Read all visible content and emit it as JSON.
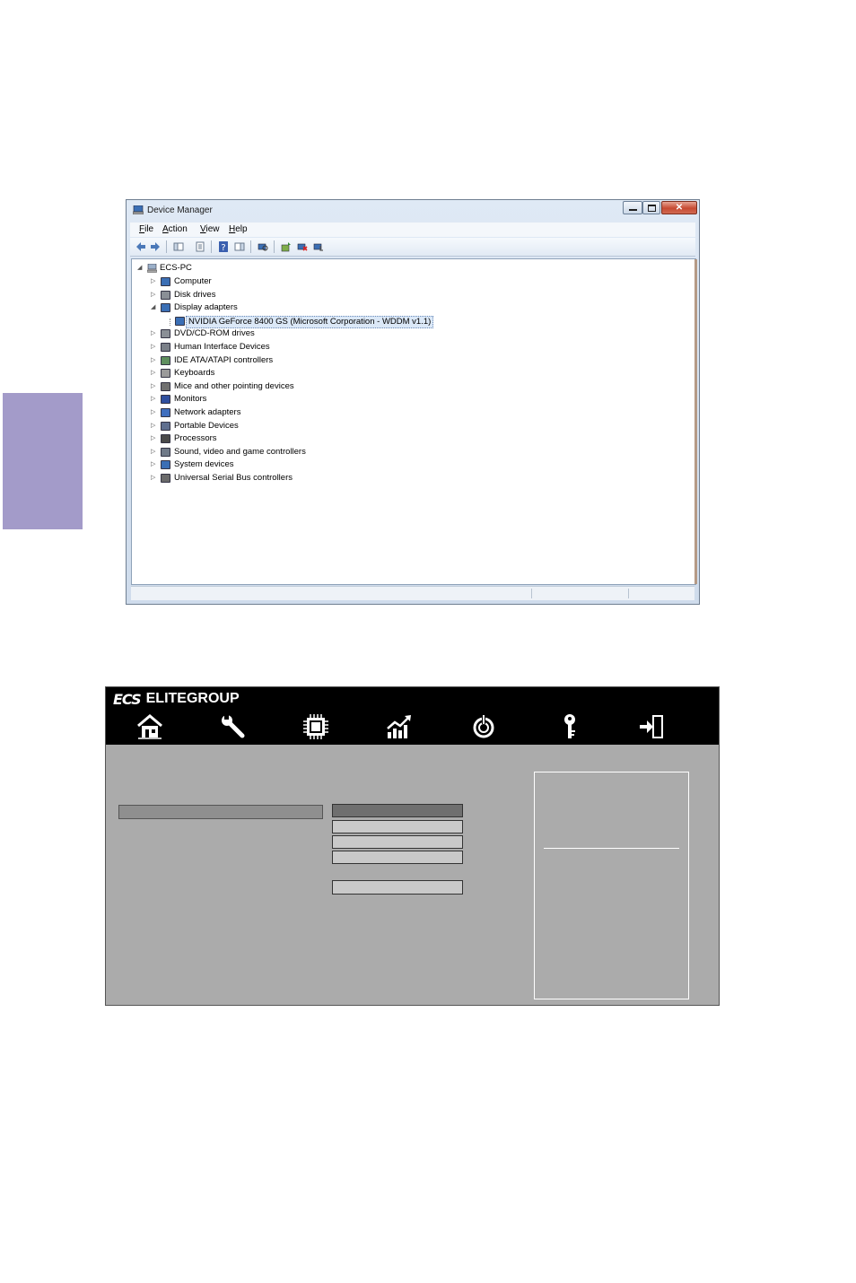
{
  "device_manager": {
    "title": "Device Manager",
    "menu": [
      {
        "accel": "F",
        "rest": "ile"
      },
      {
        "accel": "A",
        "rest": "ction"
      },
      {
        "accel": "V",
        "rest": "iew"
      },
      {
        "accel": "H",
        "rest": "elp"
      }
    ],
    "tree": {
      "root": "ECS-PC",
      "items": [
        {
          "label": "Computer",
          "expanded": false
        },
        {
          "label": "Disk drives",
          "expanded": false
        },
        {
          "label": "Display adapters",
          "expanded": true
        },
        {
          "label": "NVIDIA GeForce 8400 GS (Microsoft Corporation - WDDM v1.1)",
          "child": true,
          "selected": true
        },
        {
          "label": "DVD/CD-ROM drives",
          "expanded": false
        },
        {
          "label": "Human Interface Devices",
          "expanded": false
        },
        {
          "label": "IDE ATA/ATAPI controllers",
          "expanded": false
        },
        {
          "label": "Keyboards",
          "expanded": false
        },
        {
          "label": "Mice and other pointing devices",
          "expanded": false
        },
        {
          "label": "Monitors",
          "expanded": false
        },
        {
          "label": "Network adapters",
          "expanded": false
        },
        {
          "label": "Portable Devices",
          "expanded": false
        },
        {
          "label": "Processors",
          "expanded": false
        },
        {
          "label": "Sound, video and game controllers",
          "expanded": false
        },
        {
          "label": "System devices",
          "expanded": false
        },
        {
          "label": "Universal Serial Bus controllers",
          "expanded": false
        }
      ]
    }
  },
  "bios": {
    "brand": "ELITEGROUP",
    "logo_mark": "ECS",
    "nav_icons": [
      "home-icon",
      "wrench-icon",
      "chip-icon",
      "performance-chart-icon",
      "power-icon",
      "key-icon",
      "exit-icon"
    ]
  },
  "colors": {
    "side_tab": "#a39bc9",
    "bios_bg": "#ababab",
    "bios_header": "#000000"
  }
}
